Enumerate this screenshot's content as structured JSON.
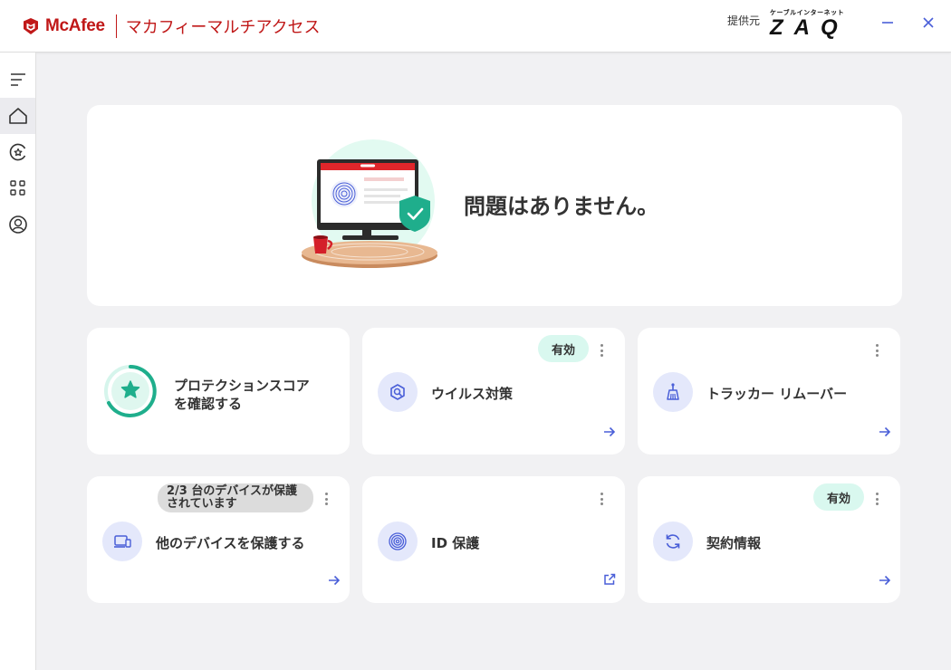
{
  "titlebar": {
    "brand_name": "McAfee",
    "product_name": "マカフィーマルチアクセス",
    "provider_label": "提供元",
    "provider_logo_small": "ケーブルインターネット",
    "provider_logo_big": "ZAQ"
  },
  "colors": {
    "brand_red": "#c01818",
    "accent_blue": "#4a5fd8",
    "badge_green": "#d9f8ef",
    "teal": "#20b28e"
  },
  "sidebar": {
    "items": [
      {
        "name": "menu",
        "icon": "hamburger-icon"
      },
      {
        "name": "home",
        "icon": "home-icon",
        "active": true
      },
      {
        "name": "protection",
        "icon": "shield-star-icon"
      },
      {
        "name": "apps",
        "icon": "grid-icon"
      },
      {
        "name": "account",
        "icon": "user-icon"
      }
    ]
  },
  "hero": {
    "status": "問題はありません。"
  },
  "cards": {
    "protection_score": {
      "label": "プロテクションスコアを確認する"
    },
    "antivirus": {
      "label": "ウイルス対策",
      "badge": "有効"
    },
    "tracker": {
      "label": "トラッカー リムーバー"
    },
    "devices": {
      "label": "他のデバイスを保護する",
      "badge": "2/3 台のデバイスが保護されています"
    },
    "identity": {
      "label": "ID 保護"
    },
    "subscription": {
      "label": "契約情報",
      "badge": "有効"
    }
  }
}
